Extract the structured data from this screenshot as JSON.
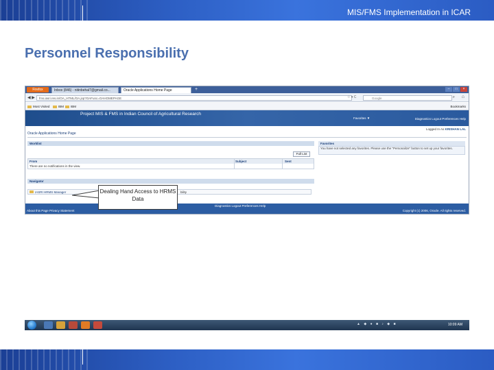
{
  "slide": {
    "header_text": "MIS/FMS Implementation in ICAR",
    "title": "Personnel Responsibility"
  },
  "browser": {
    "menu_button": "Firefox",
    "tabs": [
      {
        "label": "Inbox (846) - nitinbehal7@gmail.co...",
        "close": "×"
      },
      {
        "label": "Oracle Applications Home Page",
        "close": "×"
      }
    ],
    "new_tab": "+",
    "window_controls": {
      "minimize": "–",
      "maximize": "□",
      "close": "×"
    },
    "url": "fms.iasri.res.in/OA_HTML/OA.jsp?OAFunc=OAHOMEPAGE",
    "search_placeholder": "Google",
    "bookmarks": [
      {
        "label": "Most Visited"
      },
      {
        "label": "IBM"
      },
      {
        "label": "IBM"
      }
    ],
    "bookmarks_menu": "Bookmarks"
  },
  "oracle": {
    "app_title": "Project MIS & FMS in Indian Council of Agricultural Research",
    "favorites_menu": "Favorites ▼",
    "global_links": "Diagnostics  Logout  Preferences  Help",
    "logged_in_prefix": "Logged In As",
    "logged_in_user": "KRISHAN LAL",
    "page_heading": "Oracle Applications Home Page",
    "worklist": {
      "heading": "Worklist",
      "full_list_button": "Full List",
      "columns": [
        "From",
        "Subject",
        "Sent"
      ],
      "empty_message": "There are no notifications in the view."
    },
    "favorites": {
      "heading": "Favorites",
      "message": "You have not selected any favorites. Please use the \"Personalize\" button to set up your favorites."
    },
    "navigator": {
      "heading": "Navigator",
      "item": "IASRI HRMS Manager",
      "item_tail": "bility"
    },
    "footer": {
      "links": "Diagnostics  Logout  Preferences  Help",
      "about": "About this Page    Privacy Statement",
      "copyright": "Copyright (c) 2006, Oracle. All rights reserved."
    }
  },
  "callout": {
    "text": "Dealing Hand Access to HRMS Data"
  },
  "taskbar": {
    "clock": "10:09 AM"
  },
  "colors": {
    "slide_band": "#2d5fc4",
    "title": "#4a6faf",
    "oracle_banner": "#2a5a9e"
  }
}
